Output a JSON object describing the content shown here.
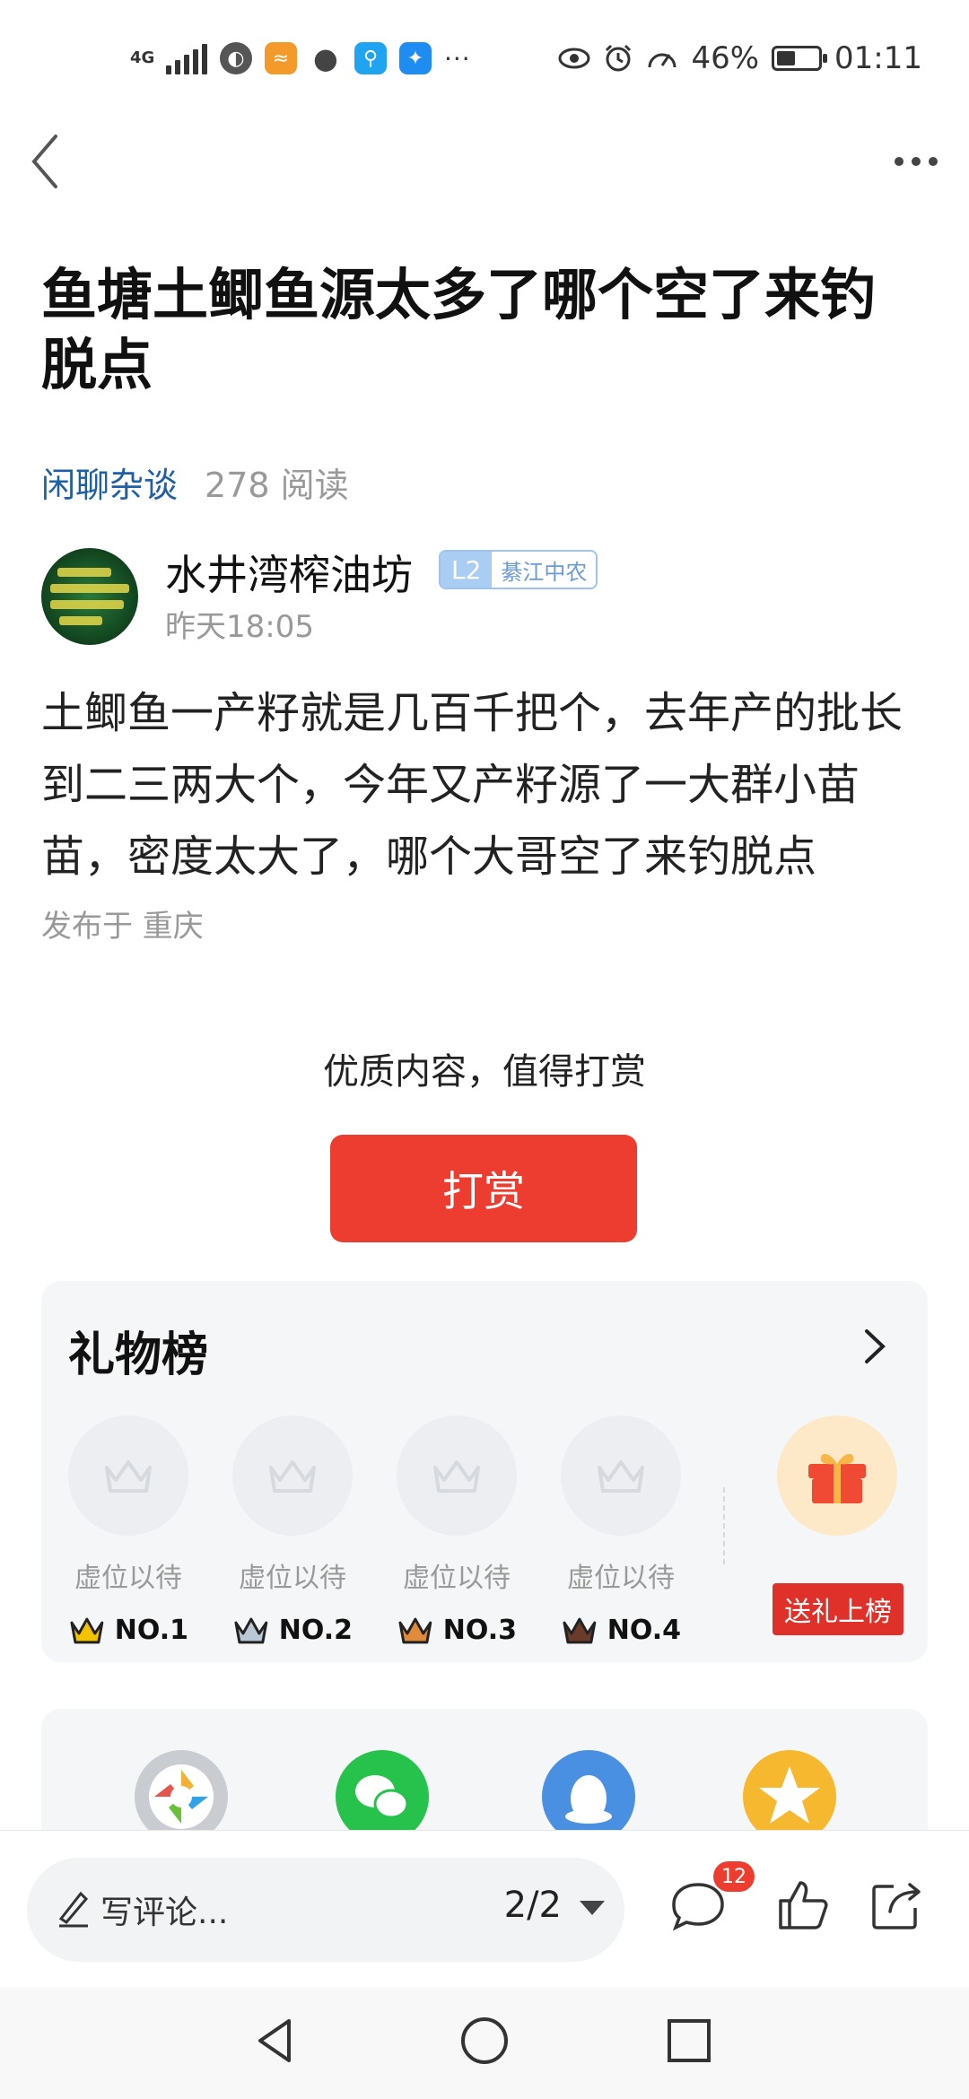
{
  "status_bar": {
    "network": "4G",
    "battery": "46%",
    "battery_level": 0.46,
    "time": "01:11",
    "more": "···"
  },
  "post": {
    "title": "鱼塘土鲫鱼源太多了哪个空了来钓脱点",
    "category": "闲聊杂谈",
    "reads": "278 阅读",
    "author_name": "水井湾榨油坊",
    "author_level": "L2",
    "author_org": "綦江中农",
    "author_time": "昨天18:05",
    "body": "土鲫鱼一产籽就是几百千把个，去年产的批长到二三两大个，今年又产籽源了一大群小苗苗，密度太大了，哪个大哥空了来钓脱点",
    "location": "发布于 重庆"
  },
  "reward": {
    "hint": "优质内容，值得打赏",
    "button": "打赏"
  },
  "gift_board": {
    "title": "礼物榜",
    "slots": [
      {
        "label": "虚位以待",
        "rank": "NO.1",
        "crown_color": "#f3c300"
      },
      {
        "label": "虚位以待",
        "rank": "NO.2",
        "crown_color": "#b9c7d6"
      },
      {
        "label": "虚位以待",
        "rank": "NO.3",
        "crown_color": "#e08a3c"
      },
      {
        "label": "虚位以待",
        "rank": "NO.4",
        "crown_color": "#6b3b2a"
      }
    ],
    "send_button": "送礼上榜"
  },
  "bottom_bar": {
    "comment_placeholder": "写评论...",
    "page_indicator": "2/2",
    "comment_count": "12"
  },
  "colors": {
    "accent_red": "#ec3d30",
    "link_blue": "#1e5fa6"
  }
}
